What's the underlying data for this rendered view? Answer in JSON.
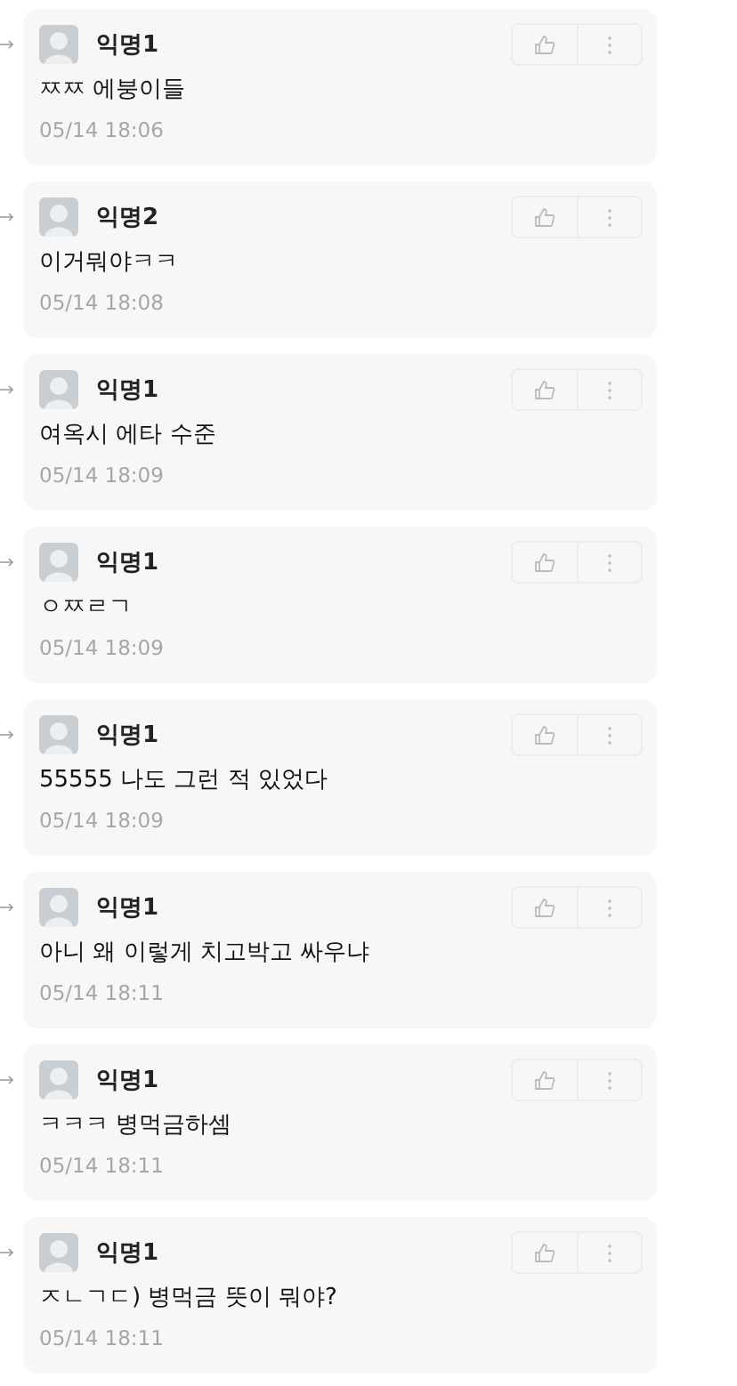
{
  "comments": [
    {
      "author": "익명1",
      "text": "ㅉㅉ 에붕이들",
      "time": "05/14 18:06"
    },
    {
      "author": "익명2",
      "text": "이거뭐야ㅋㅋ",
      "time": "05/14 18:08"
    },
    {
      "author": "익명1",
      "text": "여옥시 에타 수준",
      "time": "05/14 18:09"
    },
    {
      "author": "익명1",
      "text": "ㅇㅉㄹㄱ",
      "time": "05/14 18:09"
    },
    {
      "author": "익명1",
      "text": "55555 나도 그런 적 있었다",
      "time": "05/14 18:09"
    },
    {
      "author": "익명1",
      "text": "아니 왜 이렇게 치고박고 싸우냐",
      "time": "05/14 18:11"
    },
    {
      "author": "익명1",
      "text": "ㅋㅋㅋ 병먹금하셈",
      "time": "05/14 18:11"
    },
    {
      "author": "익명1",
      "text": "ㅈㄴㄱㄷ) 병먹금 뜻이 뭐야?",
      "time": "05/14 18:11"
    }
  ]
}
